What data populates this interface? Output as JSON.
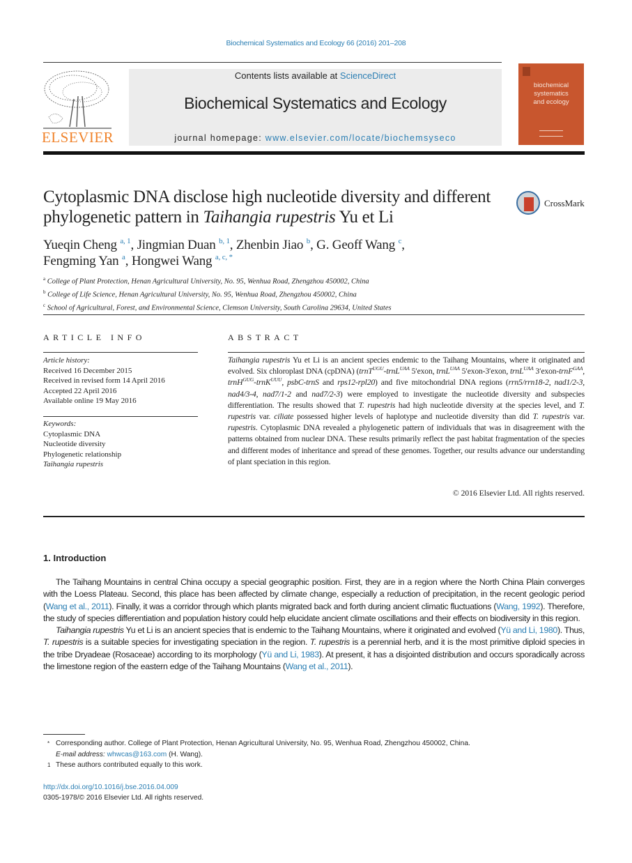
{
  "running_head": "Biochemical Systematics and Ecology 66 (2016) 201–208",
  "masthead": {
    "publisher_logo_text": "ELSEVIER",
    "contents_prefix": "Contents lists available at ",
    "contents_link": "ScienceDirect",
    "journal_title": "Biochemical Systematics and Ecology",
    "homepage_prefix": "journal homepage: ",
    "homepage_link": "www.elsevier.com/locate/biochemsyseco",
    "cover_title_lines": [
      "biochemical",
      "systematics",
      "and ecology"
    ]
  },
  "crossmark_label": "CrossMark",
  "article": {
    "title_part1": "Cytoplasmic DNA disclose high nucleotide diversity and different phylogenetic pattern in ",
    "title_italic": "Taihangia rupestris",
    "title_part2": " Yu et Li",
    "authors": [
      {
        "name": "Yueqin Cheng",
        "sup": "a, 1",
        "sep": ", "
      },
      {
        "name": "Jingmian Duan",
        "sup": "b, 1",
        "sep": ", "
      },
      {
        "name": "Zhenbin Jiao",
        "sup": "b",
        "sep": ", "
      },
      {
        "name": "G. Geoff Wang",
        "sup": "c",
        "sep": ","
      },
      {
        "name": "Fengming Yan",
        "sup": "a",
        "sep": ", "
      },
      {
        "name": "Hongwei Wang",
        "sup": "a, c, *",
        "sep": ""
      }
    ],
    "affiliations": [
      {
        "mark": "a",
        "text": "College of Plant Protection, Henan Agricultural University, No. 95, Wenhua Road, Zhengzhou 450002, China"
      },
      {
        "mark": "b",
        "text": "College of Life Science, Henan Agricultural University, No. 95, Wenhua Road, Zhengzhou 450002, China"
      },
      {
        "mark": "c",
        "text": "School of Agricultural, Forest, and Environmental Science, Clemson University, South Carolina 29634, United States"
      }
    ]
  },
  "article_info": {
    "heading": "ARTICLE INFO",
    "history_label": "Article history:",
    "history": [
      "Received 16 December 2015",
      "Received in revised form 14 April 2016",
      "Accepted 22 April 2016",
      "Available online 19 May 2016"
    ],
    "keywords_label": "Keywords:",
    "keywords": [
      "Cytoplasmic DNA",
      "Nucleotide diversity",
      "Phylogenetic relationship"
    ],
    "keyword_italic": "Taihangia rupestris"
  },
  "abstract": {
    "heading": "ABSTRACT",
    "segments": [
      {
        "t": "Taihangia rupestris",
        "i": true
      },
      {
        "t": " Yu et Li is an ancient species endemic to the Taihang Mountains, where it originated and evolved. Six chloroplast DNA (cpDNA) ("
      },
      {
        "t": "trnT",
        "i": true
      },
      {
        "t": "UGU",
        "sup": true
      },
      {
        "t": "-",
        "i": true
      },
      {
        "t": "trnL",
        "i": true
      },
      {
        "t": "UAA",
        "sup": true
      },
      {
        "t": " 5′exon, "
      },
      {
        "t": "trnL",
        "i": true
      },
      {
        "t": "UAA",
        "sup": true
      },
      {
        "t": " 5′exon-3′exon, "
      },
      {
        "t": "trnL",
        "i": true
      },
      {
        "t": "UAA",
        "sup": true
      },
      {
        "t": " 3′exon-"
      },
      {
        "t": "trnF",
        "i": true
      },
      {
        "t": "GAA",
        "sup": true
      },
      {
        "t": ", "
      },
      {
        "t": "trnH",
        "i": true
      },
      {
        "t": "GUG",
        "sup": true
      },
      {
        "t": "-",
        "i": true
      },
      {
        "t": "trnK",
        "i": true
      },
      {
        "t": "UUU",
        "sup": true
      },
      {
        "t": ", "
      },
      {
        "t": "psbC-trnS",
        "i": true
      },
      {
        "t": " and "
      },
      {
        "t": "rps12-rpl20",
        "i": true
      },
      {
        "t": ") and five mitochondrial DNA regions ("
      },
      {
        "t": "rrn5/rrn18-2",
        "i": true
      },
      {
        "t": ", "
      },
      {
        "t": "nad1/2-3",
        "i": true
      },
      {
        "t": ", "
      },
      {
        "t": "nad4/3-4",
        "i": true
      },
      {
        "t": ", "
      },
      {
        "t": "nad7/1-2",
        "i": true
      },
      {
        "t": " and "
      },
      {
        "t": "nad7/2-3",
        "i": true
      },
      {
        "t": ") were employed to investigate the nucleotide diversity and subspecies differentiation. The results showed that "
      },
      {
        "t": "T. rupestris",
        "i": true
      },
      {
        "t": " had high nucleotide diversity at the species level, and "
      },
      {
        "t": "T. rupestris",
        "i": true
      },
      {
        "t": " var. "
      },
      {
        "t": "ciliate",
        "i": true
      },
      {
        "t": " possessed higher levels of haplotype and nucleotide diversity than did "
      },
      {
        "t": "T. rupestris",
        "i": true
      },
      {
        "t": " var. "
      },
      {
        "t": "rupestris",
        "i": true
      },
      {
        "t": ". Cytoplasmic DNA revealed a phylogenetic pattern of individuals that was in disagreement with the patterns obtained from nuclear DNA. These results primarily reflect the past habitat fragmentation of the species and different modes of inheritance and spread of these genomes. Together, our results advance our understanding of plant speciation in this region."
      }
    ],
    "copyright": "© 2016 Elsevier Ltd. All rights reserved."
  },
  "introduction": {
    "heading": "1.  Introduction",
    "paragraphs": [
      [
        {
          "t": "The Taihang Mountains in central China occupy a special geographic position. First, they are in a region where the North China Plain converges with the Loess Plateau. Second, this place has been affected by climate change, especially a reduction of precipitation, in the recent geologic period ("
        },
        {
          "t": "Wang et al., 2011",
          "link": true
        },
        {
          "t": "). Finally, it was a corridor through which plants migrated back and forth during ancient climatic fluctuations ("
        },
        {
          "t": "Wang, 1992",
          "link": true
        },
        {
          "t": "). Therefore, the study of species differentiation and population history could help elucidate ancient climate oscillations and their effects on biodiversity in this region."
        }
      ],
      [
        {
          "t": "Taihangia rupestris",
          "i": true
        },
        {
          "t": " Yu et Li is an ancient species that is endemic to the Taihang Mountains, where it originated and evolved ("
        },
        {
          "t": "Yü and Li, 1980",
          "link": true
        },
        {
          "t": "). Thus, "
        },
        {
          "t": "T. rupestris",
          "i": true
        },
        {
          "t": " is a suitable species for investigating speciation in the region. "
        },
        {
          "t": "T. rupestris",
          "i": true
        },
        {
          "t": " is a perennial herb, and it is the most primitive diploid species in the tribe Dryadeae (Rosaceae) according to its morphology ("
        },
        {
          "t": "Yü and Li, 1983",
          "link": true
        },
        {
          "t": "). At present, it has a disjointed distribution and occurs sporadically across the limestone region of the eastern edge of the Taihang Mountains ("
        },
        {
          "t": "Wang et al., 2011",
          "link": true
        },
        {
          "t": ")."
        }
      ]
    ]
  },
  "footnotes": {
    "corresponding_mark": "*",
    "corresponding_text": "Corresponding author. College of Plant Protection, Henan Agricultural University, No. 95, Wenhua Road, Zhengzhou 450002, China.",
    "email_label": "E-mail address:",
    "email": "whwcas@163.com",
    "email_suffix": " (H. Wang).",
    "equal_mark": "1",
    "equal_text": "These authors contributed equally to this work."
  },
  "doi": {
    "link": "http://dx.doi.org/10.1016/j.bse.2016.04.009",
    "issn_line": "0305-1978/© 2016 Elsevier Ltd. All rights reserved."
  },
  "colors": {
    "link": "#2a7eb3",
    "elsevier_orange": "#f0832b",
    "cover_orange": "#c8562e",
    "banner_gray": "#ececec"
  }
}
